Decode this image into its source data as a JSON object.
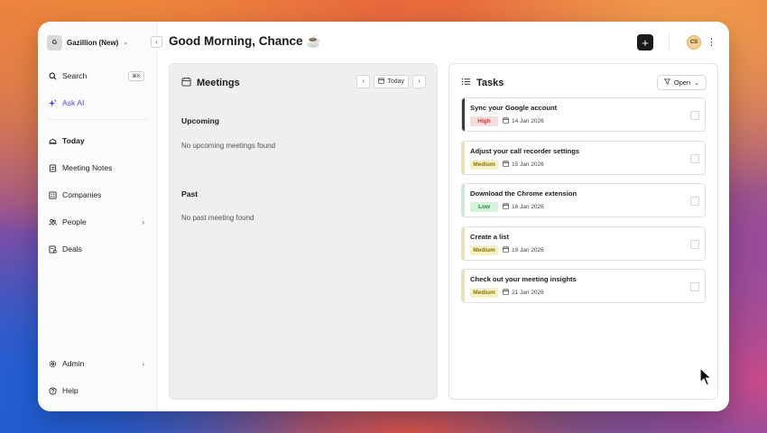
{
  "colors": {
    "accent_ai": "#5a3fd1",
    "priority_high_bg": "#f6dcdc",
    "priority_high_text": "#d4342c",
    "priority_medium_bg": "#f6f0c8",
    "priority_medium_text": "#8a7400",
    "priority_low_bg": "#d7f3dc",
    "priority_low_text": "#1f8a3b",
    "task_bar_high": "#3b3b3b",
    "task_bar_medium": "#e9e3b4",
    "task_bar_low": "#cfe9d5"
  },
  "workspace": {
    "badge": "G",
    "name": "Gazillion (New)"
  },
  "sidebar": {
    "search": {
      "label": "Search",
      "shortcut": "⌘K",
      "icon": "search-icon"
    },
    "ask_ai": {
      "label": "Ask AI",
      "icon": "sparkle-icon"
    },
    "items": [
      {
        "label": "Today",
        "icon": "cloche-icon",
        "active": true
      },
      {
        "label": "Meeting Notes",
        "icon": "notes-icon"
      },
      {
        "label": "Companies",
        "icon": "building-icon"
      },
      {
        "label": "People",
        "icon": "people-icon",
        "has_submenu": true
      },
      {
        "label": "Deals",
        "icon": "deal-icon"
      }
    ],
    "bottom": [
      {
        "label": "Admin",
        "icon": "gear-icon",
        "has_submenu": true
      },
      {
        "label": "Help",
        "icon": "help-icon"
      }
    ]
  },
  "header": {
    "greeting": "Good Morning, Chance ☕",
    "avatar_initials": "CS"
  },
  "meetings": {
    "title": "Meetings",
    "today_label": "Today",
    "upcoming_label": "Upcoming",
    "upcoming_empty": "No upcoming meetings found",
    "past_label": "Past",
    "past_empty": "No past meeting found"
  },
  "tasks": {
    "title": "Tasks",
    "filter_label": "Open",
    "items": [
      {
        "title": "Sync your Google account",
        "priority": "High",
        "date": "14 Jan 2026"
      },
      {
        "title": "Adjust your call recorder settings",
        "priority": "Medium",
        "date": "15 Jan 2026"
      },
      {
        "title": "Download the Chrome extension",
        "priority": "Low",
        "date": "16 Jan 2026"
      },
      {
        "title": "Create a list",
        "priority": "Medium",
        "date": "19 Jan 2026"
      },
      {
        "title": "Check out your meeting insights",
        "priority": "Medium",
        "date": "21 Jan 2026"
      }
    ]
  }
}
